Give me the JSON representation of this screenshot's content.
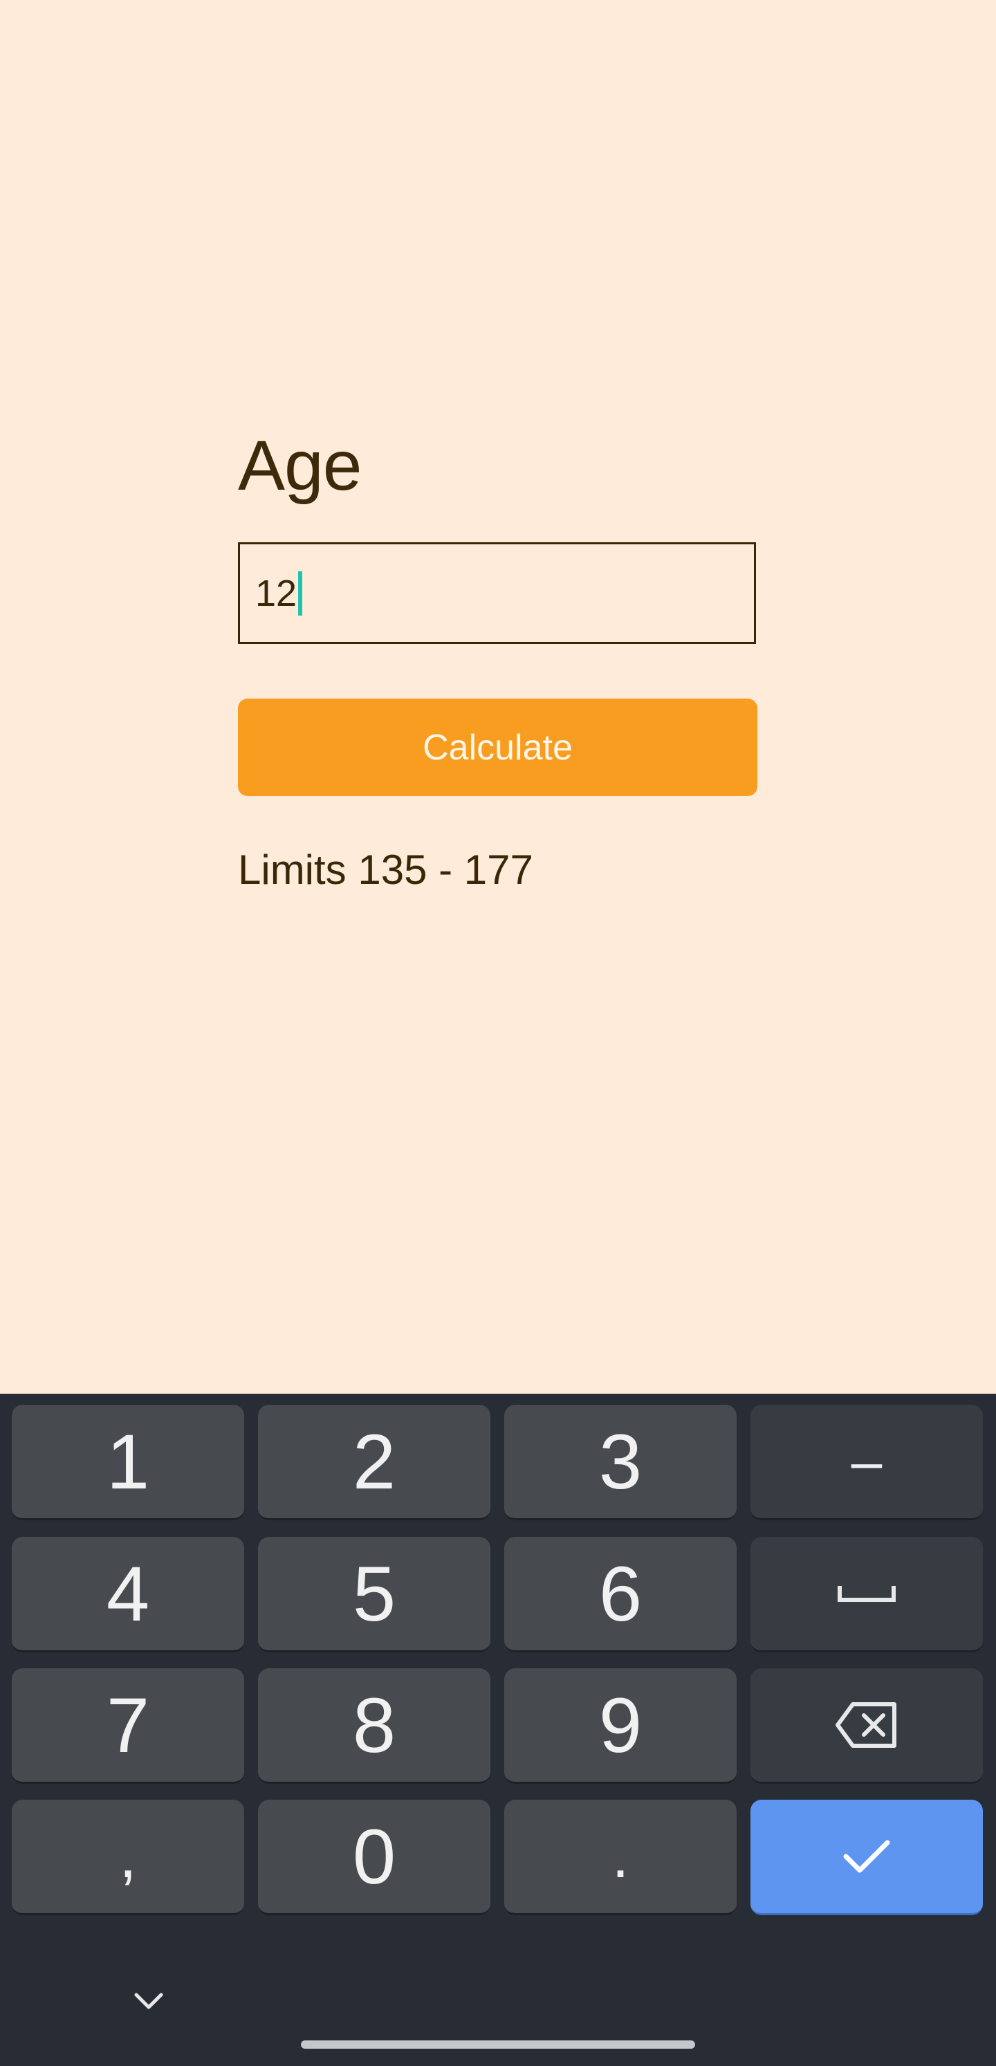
{
  "form": {
    "label": "Age",
    "input_value": "12",
    "calculate_label": "Calculate",
    "limits_text": "Limits 135 - 177"
  },
  "keyboard": {
    "keys": [
      "1",
      "2",
      "3",
      "–",
      "4",
      "5",
      "6",
      "7",
      "8",
      "9",
      ",",
      "0",
      "."
    ],
    "icons": {
      "space": "space-icon",
      "backspace": "backspace-icon",
      "done": "checkmark-icon",
      "hide": "chevron-down-icon"
    }
  },
  "colors": {
    "background": "#FFEBD9",
    "accent": "#F99D20",
    "text": "#3A2708",
    "keyboard_bg": "#282C34",
    "key_bg": "#474B50",
    "done_key": "#5E95F0",
    "caret": "#1FC3B0"
  }
}
